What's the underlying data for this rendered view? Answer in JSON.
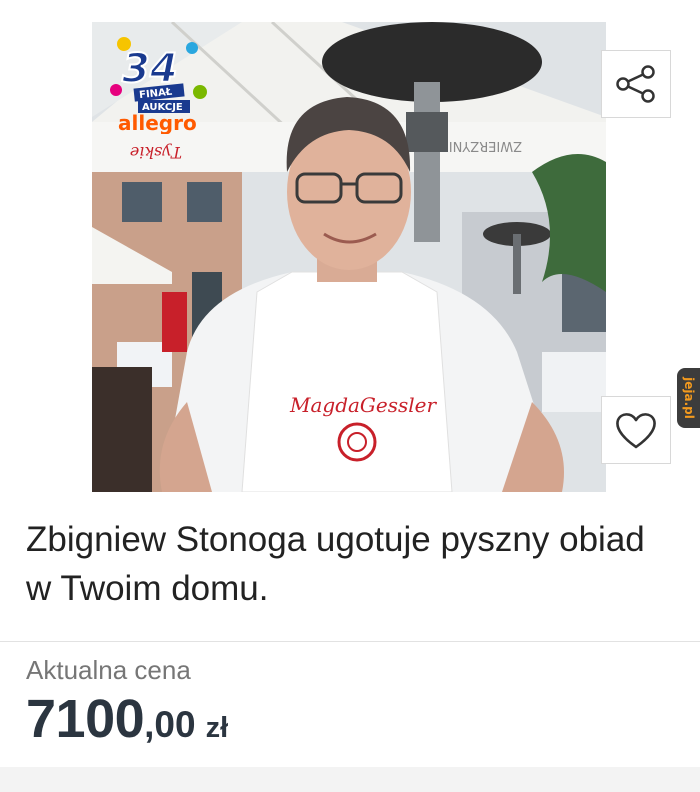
{
  "listing": {
    "title": "Zbigniew Stonoga ugotuje pyszny obiad w Twoim domu.",
    "price_label": "Aktualna cena",
    "price_integer": "7100",
    "price_decimal": ",00",
    "currency": "zł"
  },
  "badge": {
    "number": "34",
    "line1": "FINAŁ",
    "line2": "AUKCJE",
    "brand": "allegro"
  },
  "apron_text": "MagdaGessler",
  "umbrella_text": "ZWIERZYNIEC",
  "watermark": "jeja.pl",
  "actions": {
    "share_icon": "share-icon",
    "favorite_icon": "heart-icon"
  },
  "colors": {
    "price": "#2b3540",
    "label": "#767676",
    "allegro_orange": "#ff5a00",
    "apron_red": "#c8202a"
  }
}
